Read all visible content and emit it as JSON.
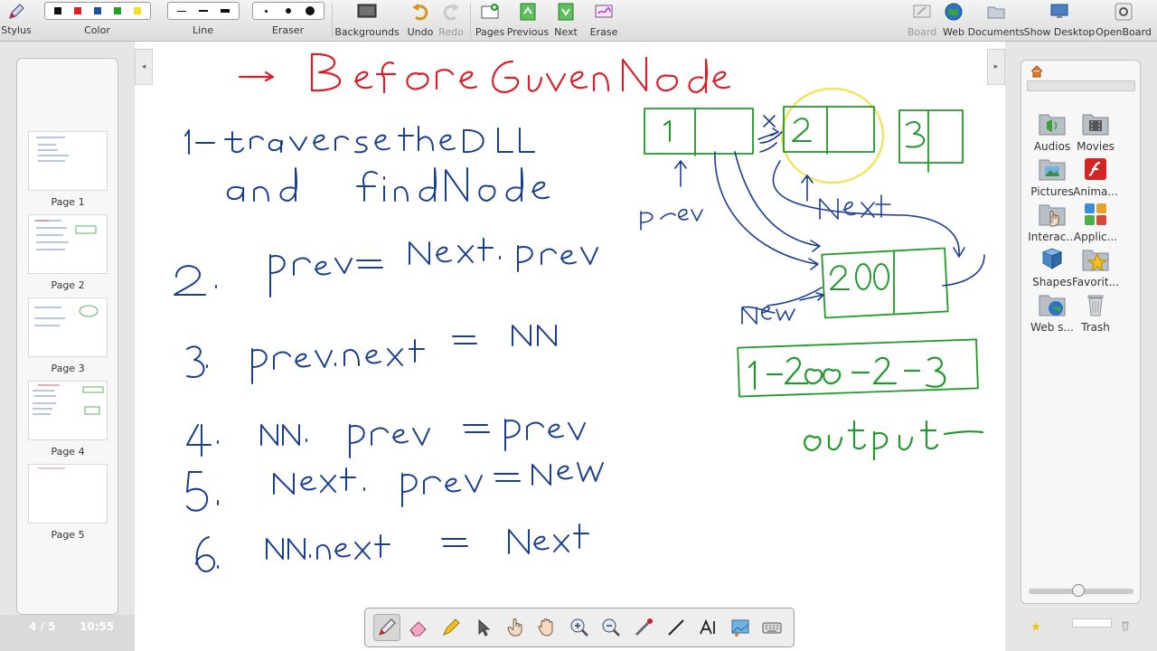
{
  "toolbar": {
    "stylus": "Stylus",
    "color": "Color",
    "line": "Line",
    "eraser": "Eraser",
    "backgrounds": "Backgrounds",
    "undo": "Undo",
    "redo": "Redo",
    "pages": "Pages",
    "previous": "Previous",
    "next": "Next",
    "erase": "Erase",
    "board": "Board",
    "web": "Web",
    "documents": "Documents",
    "show_desktop": "Show Desktop",
    "openboard": "OpenBoard"
  },
  "colors": {
    "black": "#111111",
    "red": "#e02020",
    "blue": "#1a4fa0",
    "green": "#22a022",
    "yellow": "#f0e020",
    "ink_red": "#d8202a",
    "ink_blue": "#1b3f8f",
    "ink_green": "#1f9a2a",
    "ink_yellow": "#f2e45a"
  },
  "pages_panel": {
    "pages": [
      {
        "label": "Page 1"
      },
      {
        "label": "Page 2"
      },
      {
        "label": "Page 3"
      },
      {
        "label": "Page 4"
      },
      {
        "label": "Page 5"
      }
    ],
    "page_counter": "4 / 5",
    "clock": "10:55"
  },
  "library": {
    "items": [
      {
        "label": "Audios",
        "icon": "audio-folder-icon"
      },
      {
        "label": "Movies",
        "icon": "movie-folder-icon"
      },
      {
        "label": "Pictures",
        "icon": "picture-folder-icon"
      },
      {
        "label": "Anima...",
        "icon": "flash-animation-icon"
      },
      {
        "label": "Interac...",
        "icon": "interactive-folder-icon"
      },
      {
        "label": "Applic...",
        "icon": "applications-icon"
      },
      {
        "label": "Shapes",
        "icon": "shapes-icon"
      },
      {
        "label": "Favorit...",
        "icon": "favorites-star-icon"
      },
      {
        "label": "Web s...",
        "icon": "web-search-icon"
      },
      {
        "label": "Trash",
        "icon": "trash-icon"
      }
    ]
  },
  "board": {
    "title": "→ Before Given Node",
    "steps": [
      "1- traverse the DLL",
      "and find Node",
      "2. prev = Next.prev",
      "3. prev.next = NN",
      "4. NN.prev = prev",
      "5. Next.prev = New",
      "6. NN.next = Next"
    ],
    "diagram": {
      "nodes": [
        "1",
        "2",
        "3",
        "200"
      ],
      "labels": [
        "prev",
        "Next",
        "New"
      ],
      "result": "1-200-2-3",
      "output_label": "output"
    }
  },
  "dock": {
    "tools": [
      "pen-tool",
      "eraser-tool",
      "marker-tool",
      "selector-tool",
      "interact-tool",
      "hand-tool",
      "zoom-in-tool",
      "zoom-out-tool",
      "laser-pointer-tool",
      "line-tool",
      "text-tool",
      "capture-tool",
      "keyboard-tool"
    ]
  }
}
